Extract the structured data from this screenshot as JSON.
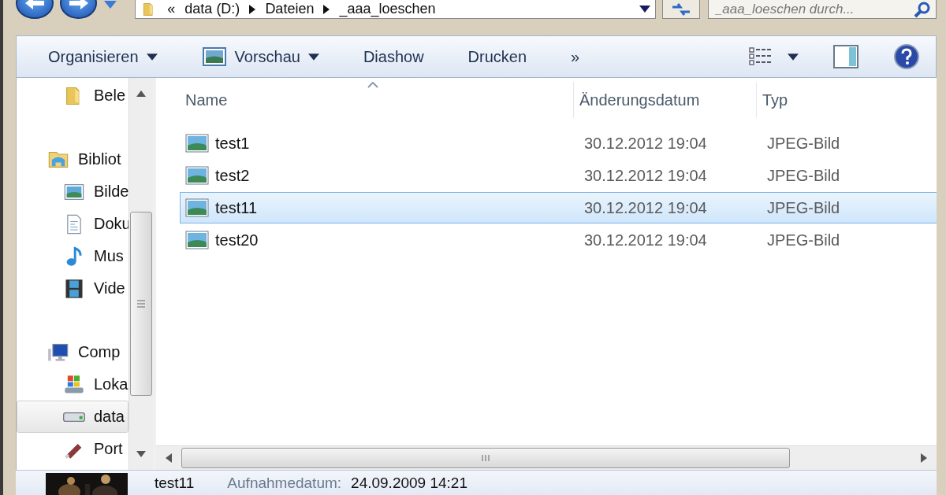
{
  "address": {
    "overflow": "«",
    "crumbs": [
      "data (D:)",
      "Dateien",
      "_aaa_loeschen"
    ]
  },
  "search": {
    "placeholder": "_aaa_loeschen durch..."
  },
  "toolbar": [
    {
      "kind": "menu",
      "label": "Organisieren"
    },
    {
      "kind": "preview-menu",
      "label": "Vorschau"
    },
    {
      "kind": "plain",
      "label": "Diashow"
    },
    {
      "kind": "plain",
      "label": "Drucken"
    },
    {
      "kind": "plain",
      "label": "»"
    }
  ],
  "nav": [
    {
      "items": [
        {
          "label": "Bele",
          "kind": "folder",
          "selected": false
        }
      ]
    },
    {
      "items": [
        {
          "label": "Bibliot",
          "kind": "library",
          "selected": false,
          "children": [
            {
              "label": "Bilde",
              "kind": "pictures",
              "selected": false
            },
            {
              "label": "Doku",
              "kind": "document",
              "selected": false
            },
            {
              "label": "Mus",
              "kind": "music",
              "selected": false
            },
            {
              "label": "Vide",
              "kind": "video",
              "selected": false
            }
          ]
        }
      ]
    },
    {
      "items": [
        {
          "label": "Comp",
          "kind": "computer",
          "selected": false,
          "children": [
            {
              "label": "Loka",
              "kind": "system-drive",
              "selected": false
            },
            {
              "label": "data",
              "kind": "drive",
              "selected": true
            },
            {
              "label": "Port",
              "kind": "usb",
              "selected": false
            }
          ]
        }
      ]
    }
  ],
  "table": {
    "columns": [
      "Name",
      "Änderungsdatum",
      "Typ"
    ],
    "rows": [
      {
        "name": "test1",
        "date": "30.12.2012 19:04",
        "type": "JPEG-Bild",
        "selected": false
      },
      {
        "name": "test2",
        "date": "30.12.2012 19:04",
        "type": "JPEG-Bild",
        "selected": false
      },
      {
        "name": "test11",
        "date": "30.12.2012 19:04",
        "type": "JPEG-Bild",
        "selected": true
      },
      {
        "name": "test20",
        "date": "30.12.2012 19:04",
        "type": "JPEG-Bild",
        "selected": false
      }
    ]
  },
  "details": {
    "name": "test11",
    "property": "Aufnahmedatum:",
    "value": "24.09.2009 14:21"
  }
}
